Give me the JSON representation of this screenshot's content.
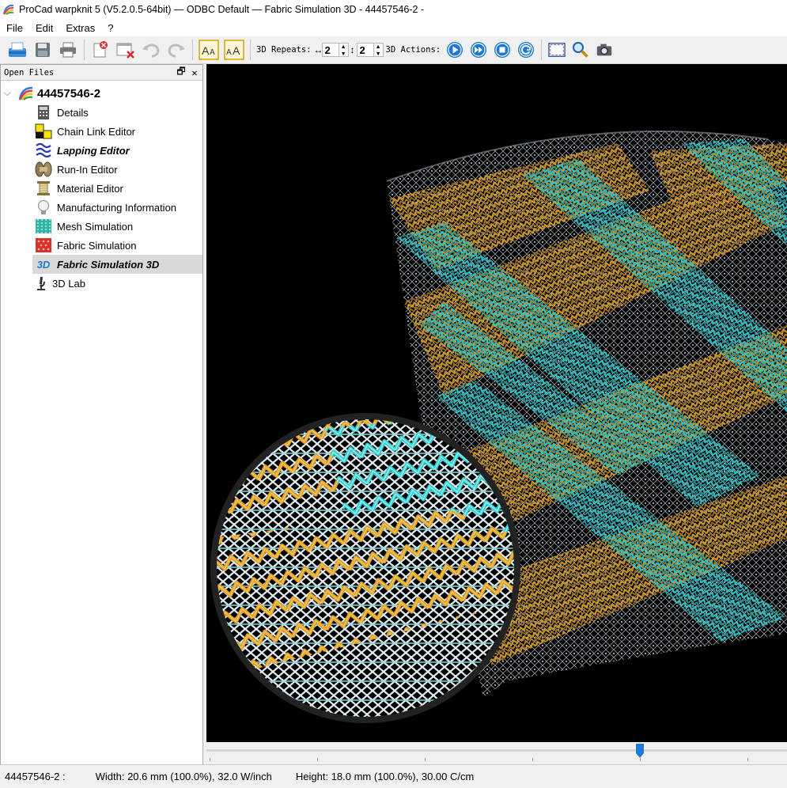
{
  "window": {
    "title": "ProCad warpknit 5 (V5.2.0.5-64bit) — ODBC Default — Fabric Simulation 3D - 44457546-2 -"
  },
  "menu": [
    "File",
    "Edit",
    "Extras",
    "?"
  ],
  "toolbar": {
    "repeats_label": "3D Repeats:",
    "repeat_h_icon": "↔",
    "repeat_h_value": "2",
    "repeat_v_icon": "↕",
    "repeat_v_value": "2",
    "actions_label": "3D Actions:",
    "buttons": [
      "open-icon",
      "save-icon",
      "print-icon",
      "delete-file-icon",
      "close-file-icon",
      "undo-icon",
      "redo-icon",
      "font-larger-icon",
      "font-smaller-icon"
    ],
    "action_buttons": [
      "play-icon",
      "fast-forward-icon",
      "stop-icon",
      "reset-icon"
    ],
    "view_buttons": [
      "fullscreen-icon",
      "zoom-icon",
      "camera-icon"
    ]
  },
  "panel": {
    "title": "Open Files",
    "restore_icon": "🗗",
    "close_icon": "✕",
    "root_label": "44457546-2",
    "items": [
      {
        "label": "Details",
        "icon": "calculator-icon"
      },
      {
        "label": "Chain Link Editor",
        "icon": "chain-link-icon"
      },
      {
        "label": "Lapping Editor",
        "icon": "lapping-icon"
      },
      {
        "label": "Run-In Editor",
        "icon": "beam-icon"
      },
      {
        "label": "Material Editor",
        "icon": "spool-icon"
      },
      {
        "label": "Manufacturing Information",
        "icon": "lightbulb-icon"
      },
      {
        "label": "Mesh Simulation",
        "icon": "mesh-icon"
      },
      {
        "label": "Fabric Simulation",
        "icon": "fabric-icon"
      },
      {
        "label": "Fabric Simulation 3D",
        "icon": "fabric-3d-icon"
      },
      {
        "label": "3D Lab",
        "icon": "microscope-icon"
      }
    ]
  },
  "fabric_3d_badge": "3D",
  "status": {
    "file": "44457546-2 :",
    "width": "Width: 20.6 mm (100.0%), 32.0 W/inch",
    "height": "Height: 18.0 mm (100.0%), 30.00 C/cm"
  },
  "slider": {
    "value_fraction": 0.75
  },
  "colors": {
    "orange_yarn": "#d99a1e",
    "cyan_yarn": "#2ec7cc",
    "white_yarn": "#e8eef2",
    "accent_blue": "#1f78d1"
  }
}
